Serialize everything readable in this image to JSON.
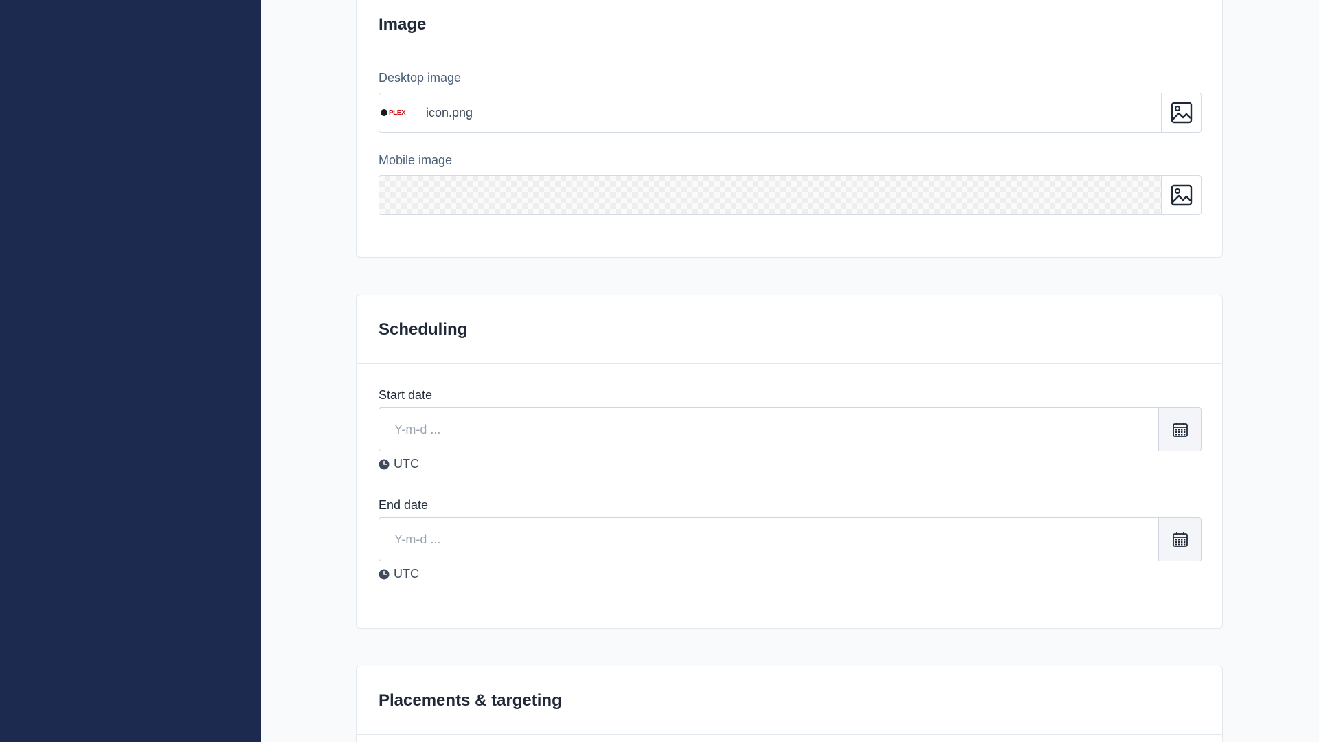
{
  "image_section": {
    "title": "Image",
    "desktop_label": "Desktop image",
    "desktop_file": "icon.png",
    "mobile_label": "Mobile image"
  },
  "scheduling": {
    "title": "Scheduling",
    "start_label": "Start date",
    "start_placeholder": "Y-m-d ...",
    "start_tz": "UTC",
    "end_label": "End date",
    "end_placeholder": "Y-m-d ...",
    "end_tz": "UTC"
  },
  "placements": {
    "title": "Placements & targeting"
  }
}
